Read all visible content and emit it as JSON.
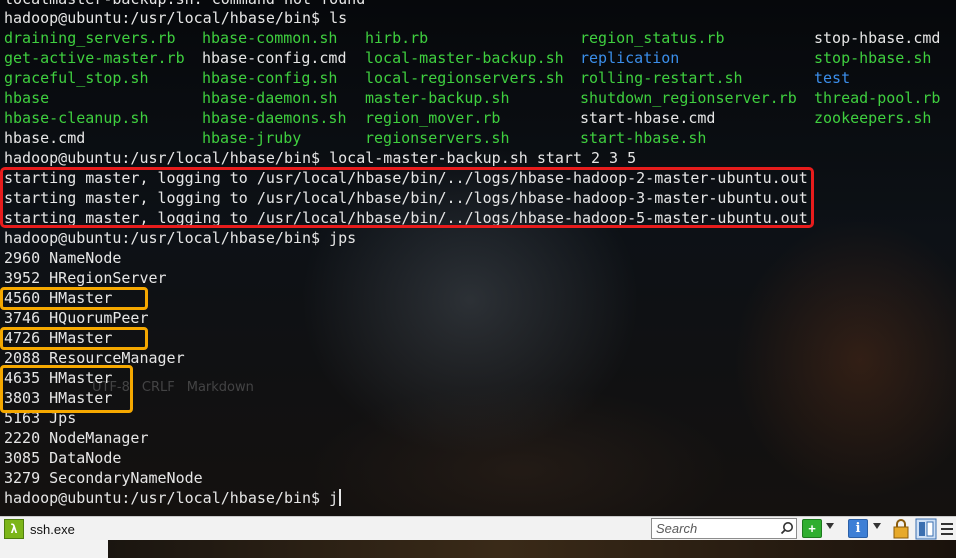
{
  "terminal": {
    "top_partial": "localmaster-backup.sh: command not found",
    "prompt1": "hadoop@ubuntu:/usr/local/hbase/bin$ ls",
    "ls_grid": [
      [
        {
          "t": "draining_servers.rb",
          "c": "exec"
        },
        {
          "t": "hbase-common.sh",
          "c": "exec"
        },
        {
          "t": "hirb.rb",
          "c": "exec"
        },
        {
          "t": "region_status.rb",
          "c": "exec"
        },
        {
          "t": "stop-hbase.cmd",
          "c": "plain"
        }
      ],
      [
        {
          "t": "get-active-master.rb",
          "c": "exec"
        },
        {
          "t": "hbase-config.cmd",
          "c": "plain"
        },
        {
          "t": "local-master-backup.sh",
          "c": "exec"
        },
        {
          "t": "replication",
          "c": "dir"
        },
        {
          "t": "stop-hbase.sh",
          "c": "exec"
        }
      ],
      [
        {
          "t": "graceful_stop.sh",
          "c": "exec"
        },
        {
          "t": "hbase-config.sh",
          "c": "exec"
        },
        {
          "t": "local-regionservers.sh",
          "c": "exec"
        },
        {
          "t": "rolling-restart.sh",
          "c": "exec"
        },
        {
          "t": "test",
          "c": "dir"
        }
      ],
      [
        {
          "t": "hbase",
          "c": "exec"
        },
        {
          "t": "hbase-daemon.sh",
          "c": "exec"
        },
        {
          "t": "master-backup.sh",
          "c": "exec"
        },
        {
          "t": "shutdown_regionserver.rb",
          "c": "exec"
        },
        {
          "t": "thread-pool.rb",
          "c": "exec"
        }
      ],
      [
        {
          "t": "hbase-cleanup.sh",
          "c": "exec"
        },
        {
          "t": "hbase-daemons.sh",
          "c": "exec"
        },
        {
          "t": "region_mover.rb",
          "c": "exec"
        },
        {
          "t": "start-hbase.cmd",
          "c": "plain"
        },
        {
          "t": "zookeepers.sh",
          "c": "exec"
        }
      ],
      [
        {
          "t": "hbase.cmd",
          "c": "plain"
        },
        {
          "t": "hbase-jruby",
          "c": "exec"
        },
        {
          "t": "regionservers.sh",
          "c": "exec"
        },
        {
          "t": "start-hbase.sh",
          "c": "exec"
        },
        {
          "t": "",
          "c": "plain"
        }
      ]
    ],
    "prompt2": "hadoop@ubuntu:/usr/local/hbase/bin$ local-master-backup.sh start 2 3 5",
    "start_lines": [
      "starting master, logging to /usr/local/hbase/bin/../logs/hbase-hadoop-2-master-ubuntu.out",
      "starting master, logging to /usr/local/hbase/bin/../logs/hbase-hadoop-3-master-ubuntu.out",
      "starting master, logging to /usr/local/hbase/bin/../logs/hbase-hadoop-5-master-ubuntu.out"
    ],
    "prompt3": "hadoop@ubuntu:/usr/local/hbase/bin$ jps",
    "jps": [
      "2960 NameNode",
      "3952 HRegionServer",
      "4560 HMaster",
      "3746 HQuorumPeer",
      "4726 HMaster",
      "2088 ResourceManager",
      "4635 HMaster",
      "3803 HMaster",
      "5163 Jps",
      "2220 NodeManager",
      "3085 DataNode",
      "3279 SecondaryNameNode"
    ],
    "prompt4": "hadoop@ubuntu:/usr/local/hbase/bin$ j"
  },
  "ghost_status": [
    "UTF-8",
    "CRLF",
    "Markdown"
  ],
  "taskbar": {
    "app_icon_glyph": "λ",
    "app_label": "ssh.exe",
    "search_placeholder": "Search",
    "add_glyph": "+",
    "info_glyph": "i",
    "icons": [
      "search-icon",
      "add-console-icon",
      "info-icon",
      "lock-icon",
      "split-view-icon",
      "menu-icon"
    ]
  },
  "colors": {
    "exec": "#3fcf3f",
    "dir": "#3b8eea",
    "highlight_red": "#e81c1c",
    "highlight_yellow": "#f5a800"
  }
}
